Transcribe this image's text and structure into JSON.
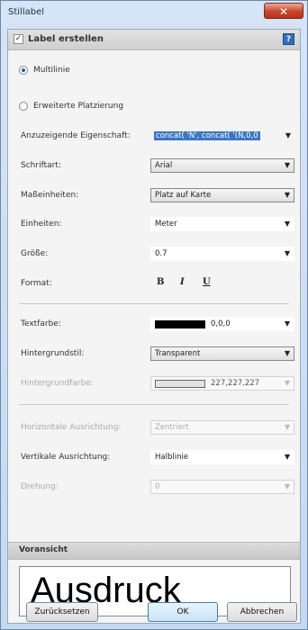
{
  "window": {
    "title": "Stillabel",
    "close_glyph": "✕"
  },
  "group": {
    "checkbox_mark": "✓",
    "label": "Label erstellen",
    "help_glyph": "?"
  },
  "mode": {
    "option_multiline": "Multilinie",
    "option_extended": "Erweiterte Platzierung"
  },
  "fields": {
    "property": {
      "label": "Anzuzeigende Eigenschaft:",
      "value": "concat( 'N', concat( '(N,0,0"
    },
    "font": {
      "label": "Schriftart:",
      "value": "Arial"
    },
    "units": {
      "label": "Maßeinheiten:",
      "value": "Platz auf Karte"
    },
    "unit": {
      "label": "Einheiten:",
      "value": "Meter"
    },
    "size": {
      "label": "Größe:",
      "value": "0.7"
    },
    "format": {
      "label": "Format:",
      "bold": "B",
      "italic": "I",
      "underline": "U"
    },
    "text_color": {
      "label": "Textfarbe:",
      "value": "0,0,0",
      "color": "#000000"
    },
    "bg_style": {
      "label": "Hintergrundstil:",
      "value": "Transparent"
    },
    "bg_color": {
      "label": "Hintergrundfarbe:",
      "value": "227,227,227",
      "color": "#e3e3e3"
    },
    "h_align": {
      "label": "Horizontale Ausrichtung:",
      "value": "Zentriert"
    },
    "v_align": {
      "label": "Vertikale Ausrichtung:",
      "value": "Halblinie"
    },
    "rotation": {
      "label": "Drehung:",
      "value": "0"
    }
  },
  "preview": {
    "title": "Voransicht",
    "sample": "Ausdruck"
  },
  "buttons": {
    "reset": "Zurücksetzen",
    "ok": "OK",
    "cancel": "Abbrechen"
  },
  "icons": {
    "dropdown": "▼"
  }
}
